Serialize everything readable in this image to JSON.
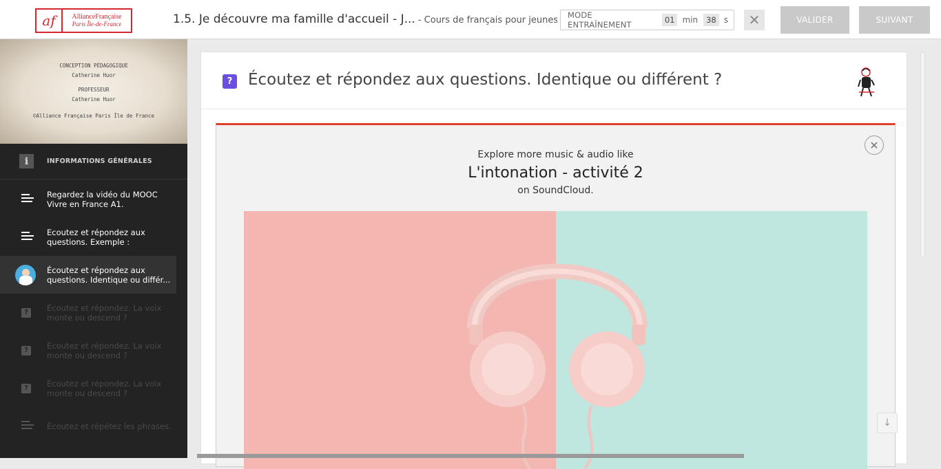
{
  "header": {
    "logo_mark": "af",
    "logo_line1": "AllianceFrançaise",
    "logo_line2": "Paris Île-de-France",
    "title": "1.5. Je découvre ma famille d'accueil - J...",
    "subtitle": "- Cours de français pour jeunes...",
    "timer": {
      "mode_label": "MODE ENTRAÎNEMENT",
      "minutes": "01",
      "min_unit": "min",
      "seconds": "38",
      "sec_unit": "s"
    },
    "close_glyph": "✕",
    "valider_label": "VALIDER",
    "suivant_label": "SUIVANT"
  },
  "sidebar": {
    "thumbnail": {
      "line1": "CONCEPTION PÉDAGOGIQUE",
      "line2": "Catherine Huor",
      "line3": "PROFESSEUR",
      "line4": "Catherine Huor",
      "line5": "©Alliance Française Paris Île de France"
    },
    "info_label": "INFORMATIONS GÉNÉRALES",
    "info_icon": "i",
    "items": [
      {
        "label": "Regardez la vidéo du MOOC Vivre en France A1.",
        "icon": "text-lines-icon",
        "state": "done"
      },
      {
        "label": "Ecoutez et répondez aux questions. Exemple :",
        "icon": "text-lines-icon",
        "state": "done"
      },
      {
        "label": "Écoutez et répondez aux questions. Identique ou différ...",
        "icon": "avatar",
        "state": "active"
      },
      {
        "label": "Écoutez et répondez. La voix monte ou descend ?",
        "icon": "question-icon",
        "state": "locked"
      },
      {
        "label": "Écoutez et répondez. La voix monte ou descend ?",
        "icon": "question-icon",
        "state": "locked"
      },
      {
        "label": "Écoutez et répondez. La voix monte ou descend ?",
        "icon": "question-icon",
        "state": "locked"
      },
      {
        "label": "Écoutez et répétez les phrases.",
        "icon": "text-lines-icon",
        "state": "locked"
      }
    ]
  },
  "main": {
    "question_badge": "?",
    "title": "Écoutez et répondez aux questions. Identique ou différent ?",
    "soundcloud": {
      "line1": "Explore more music & audio like",
      "track": "L'intonation - activité 2",
      "line3": "on SoundCloud.",
      "close_glyph": "✕"
    },
    "scroll_down_glyph": "↓"
  },
  "colors": {
    "brand_red": "#d6262f",
    "soundcloud_accent": "#e0402a",
    "question_purple": "#6b4fe0",
    "art_pink": "#f3b6b1",
    "art_mint": "#bfe6df"
  }
}
